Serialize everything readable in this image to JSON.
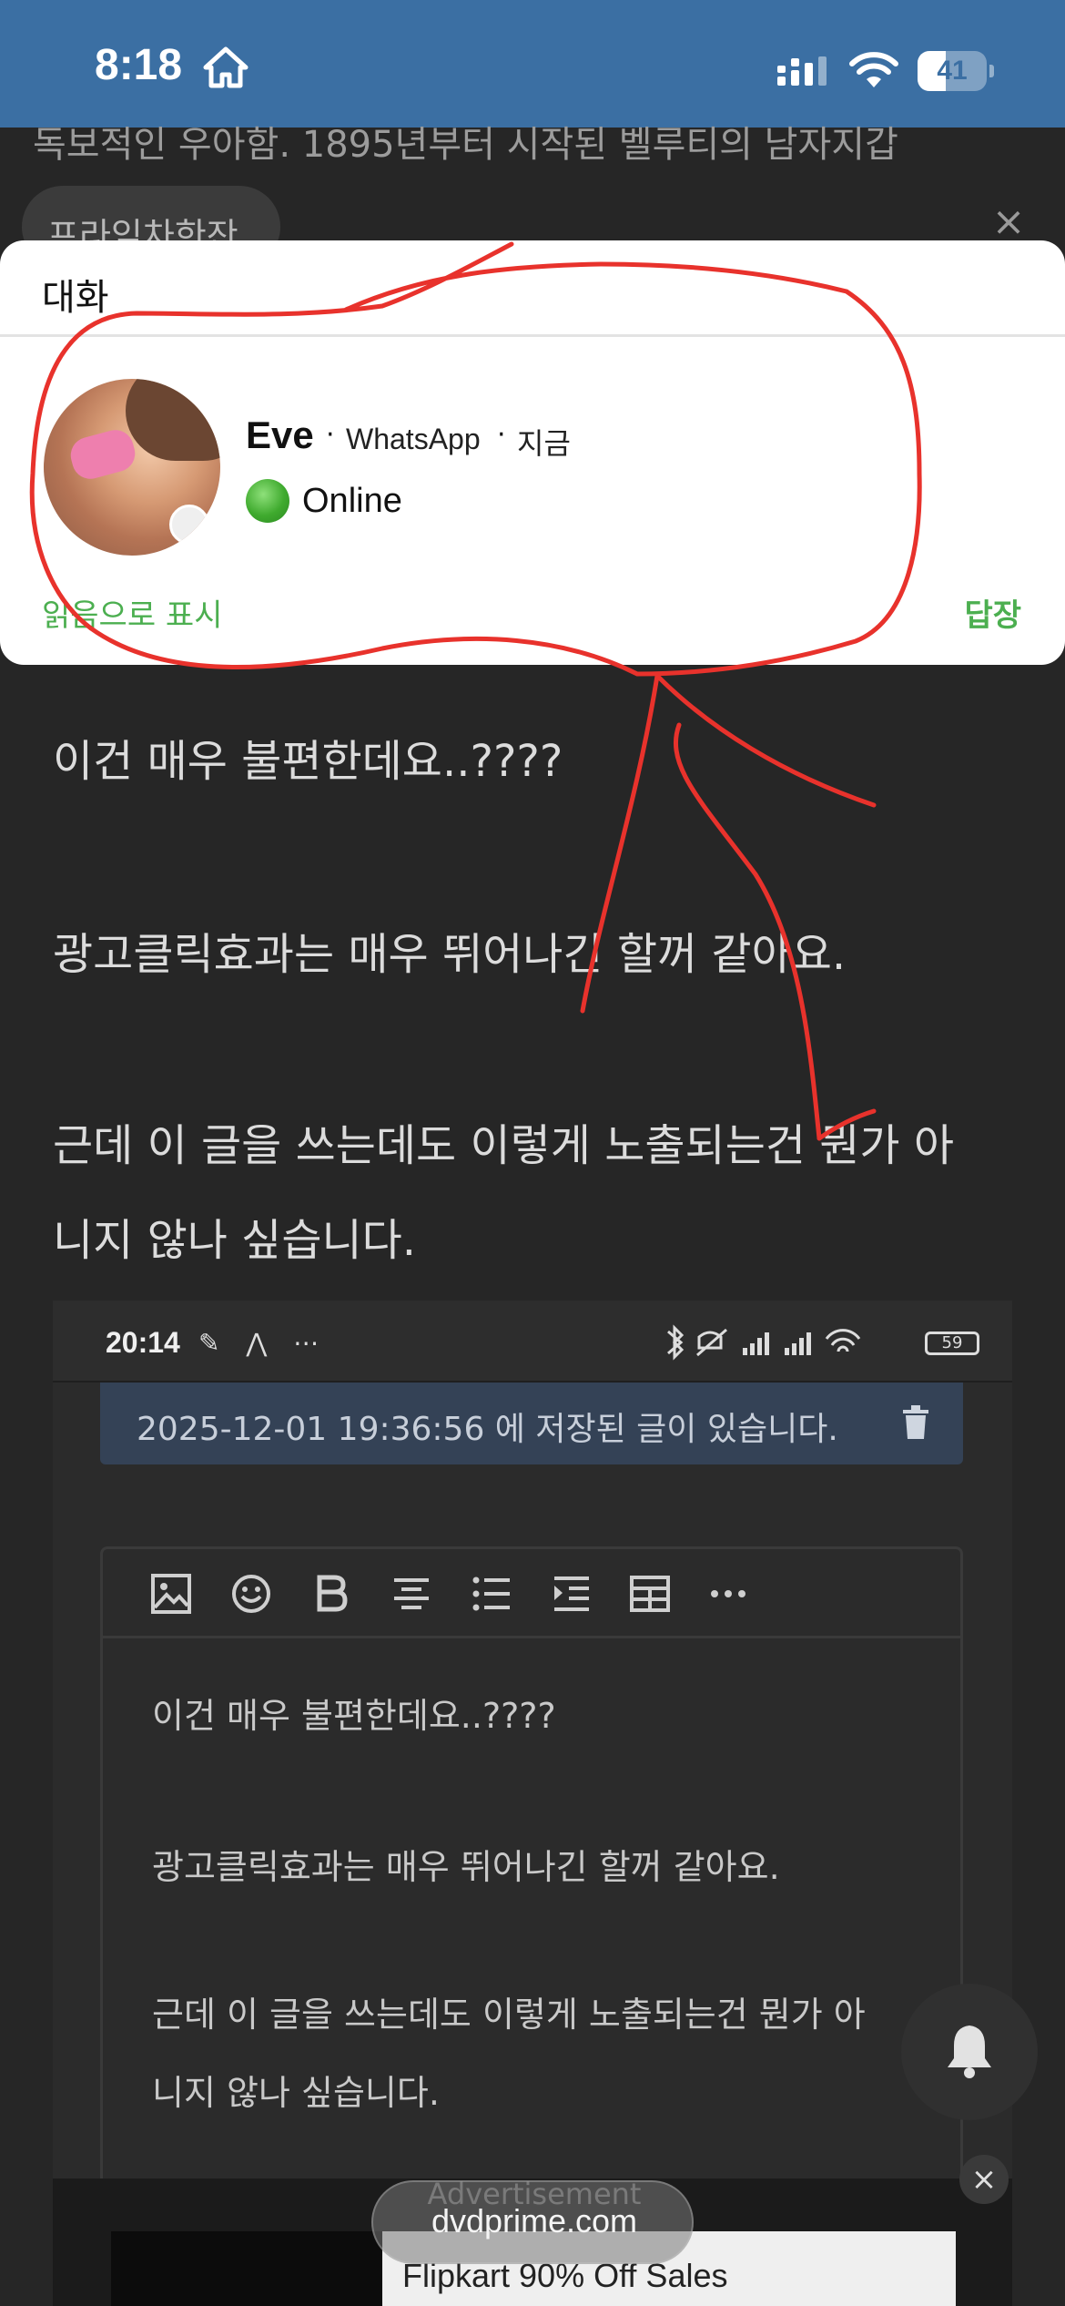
{
  "status_bar": {
    "time": "8:18",
    "battery": "41",
    "icons": [
      "home-icon",
      "signal-icon",
      "wifi-icon",
      "battery-icon"
    ]
  },
  "background": {
    "top_line": "독보적인 우아함. 1895년부터 시작된 벨루티의 남자지갑",
    "chip_label": "프라임차한잔",
    "close_glyph": "×"
  },
  "notification": {
    "header": "대화",
    "sender": "Eve",
    "separator": "·",
    "app": "WhatsApp",
    "time": "지금",
    "status": "Online",
    "action_mark_read": "읽음으로 표시",
    "action_reply": "답장"
  },
  "article": {
    "paragraphs": [
      "이건 매우 불편한데요..????",
      "광고클릭효과는 매우 뛰어나긴 할꺼 같아요.",
      "근데 이 글을 쓰는데도 이렇게 노출되는건 뭔가 아",
      "니지 않나 싶습니다."
    ]
  },
  "embedded_screenshot": {
    "time": "20:14",
    "left_icons": "✎ ⋀ ⋯",
    "battery": "59",
    "saved_notice": "2025-12-01 19:36:56 에 저장된 글이 있습니다.",
    "editor_lines": [
      "이건 매우 불편한데요..????",
      "광고클릭효과는 매우 뛰어나긴 할꺼 같아요.",
      "근데 이 글을 쓰는데도 이렇게 노출되는건 뭔가 아",
      "니지 않나 싶습니다."
    ],
    "ad_text": "Flipkart 90% Off Sales"
  },
  "floating": {
    "url": "dvdprime.com",
    "url_faded": "Advertisement",
    "ad_close": "×"
  },
  "colors": {
    "status_bar": "#3b6fa3",
    "page_bg": "#262626",
    "accent_green": "#4caf50",
    "annotation_red": "#e8322c"
  }
}
